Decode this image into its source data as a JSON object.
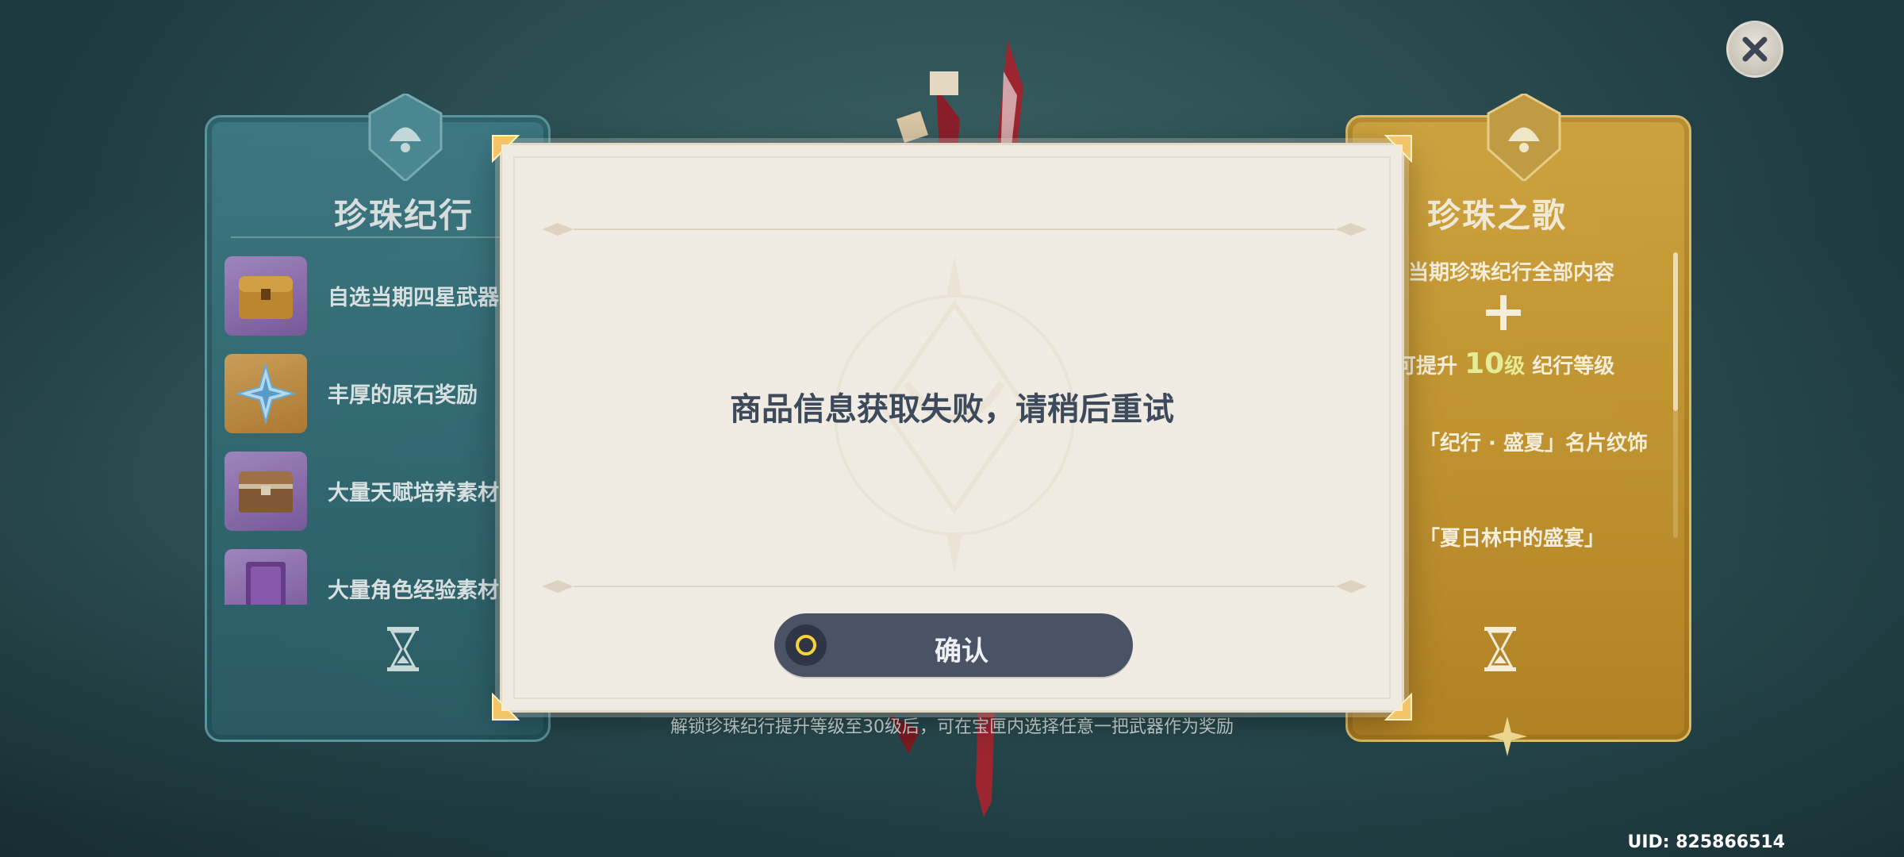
{
  "close": {
    "icon": "close-icon"
  },
  "left_card": {
    "title": "珍珠纪行",
    "items": [
      {
        "label": "自选当期四星武器",
        "icon": "weapon-chest-icon",
        "bg": "purple"
      },
      {
        "label": "丰厚的原石奖励",
        "icon": "primogem-icon",
        "bg": "gold"
      },
      {
        "label": "大量天赋培养素材",
        "icon": "treasure-chest-icon",
        "bg": "purple"
      },
      {
        "label": "大量角色经验素材",
        "icon": "exp-book-icon",
        "bg": "purple"
      }
    ]
  },
  "right_card": {
    "title": "珍珠之歌",
    "line1": "当期珍珠纪行全部内容",
    "line2_prefix": "可提升",
    "line2_num": "10",
    "line2_unit": "级",
    "line2_suffix": "纪行等级",
    "line3": "「纪行 · 盛夏」名片纹饰",
    "line4": "「夏日林中的盛宴」"
  },
  "caption": "解锁珍珠纪行提升等级至30级后，可在宝匣内选择任意一把武器作为奖励",
  "modal": {
    "message": "商品信息获取失败，请稍后重试",
    "confirm_label": "确认"
  },
  "uid": "UID: 825866514",
  "colors": {
    "left_card": "#336b74",
    "right_card": "#c8972e",
    "modal_bg": "#f1ece3",
    "button": "#4a5366",
    "button_ring": "#f3d43a"
  }
}
